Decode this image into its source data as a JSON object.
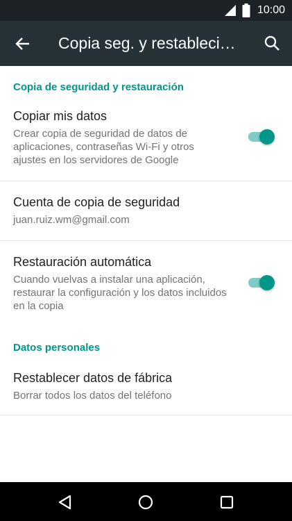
{
  "status_bar": {
    "time": "10:00",
    "icons": [
      "signal-icon",
      "battery-icon"
    ]
  },
  "toolbar": {
    "title": "Copia seg. y restablecimiento",
    "back_icon": "back-arrow-icon",
    "search_icon": "search-icon"
  },
  "sections": {
    "backup": {
      "header": "Copia de seguridad y restauración",
      "items": [
        {
          "title": "Copiar mis datos",
          "summary": "Crear copia de seguridad de datos de aplicaciones, contraseñas Wi-Fi y otros ajustes en los servidores de Google",
          "switch_on": true
        },
        {
          "title": "Cuenta de copia de seguridad",
          "summary": "juan.ruiz.wm@gmail.com"
        },
        {
          "title": "Restauración automática",
          "summary": "Cuando vuelvas a instalar una aplicación, restaurar la configuración y los datos incluidos en la copia",
          "switch_on": true
        }
      ]
    },
    "personal": {
      "header": "Datos personales",
      "items": [
        {
          "title": "Restablecer datos de fábrica",
          "summary": "Borrar todos los datos del teléfono"
        }
      ]
    }
  },
  "nav_bar": {
    "buttons": [
      "back-triangle-icon",
      "home-circle-icon",
      "recents-square-icon"
    ]
  },
  "colors": {
    "accent": "#009688",
    "toolbar": "#263238",
    "status_bar": "#1c2226",
    "switch_track": "#80cbc4"
  }
}
